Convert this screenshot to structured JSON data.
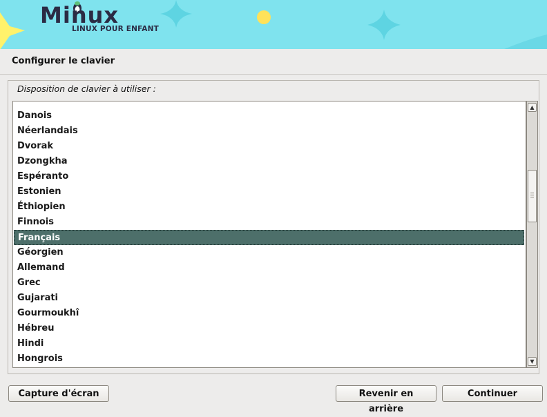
{
  "header": {
    "logo_title": "Minux",
    "logo_subtitle": "LINUX POUR ENFANT"
  },
  "page": {
    "title": "Configurer le clavier",
    "list_label": "Disposition de clavier à utiliser :"
  },
  "keyboard_layouts": {
    "items": [
      "Danois",
      "Néerlandais",
      "Dvorak",
      "Dzongkha",
      "Espéranto",
      "Estonien",
      "Éthiopien",
      "Finnois",
      "Français",
      "Géorgien",
      "Allemand",
      "Grec",
      "Gujarati",
      "Gourmoukhî",
      "Hébreu",
      "Hindi",
      "Hongrois"
    ],
    "selected": "Français"
  },
  "buttons": {
    "screenshot": "Capture d'écran",
    "back": "Revenir en arrière",
    "continue": "Continuer"
  },
  "colors": {
    "banner": "#7fe3ee",
    "selection": "#4d6f6a",
    "star": "#fff26b",
    "sparkle": "#5ed4e2",
    "dot": "#ffe259"
  },
  "icons": [
    "penguin-logo-icon",
    "star-icon",
    "sparkle-icon",
    "scroll-up-icon",
    "scroll-down-icon"
  ]
}
